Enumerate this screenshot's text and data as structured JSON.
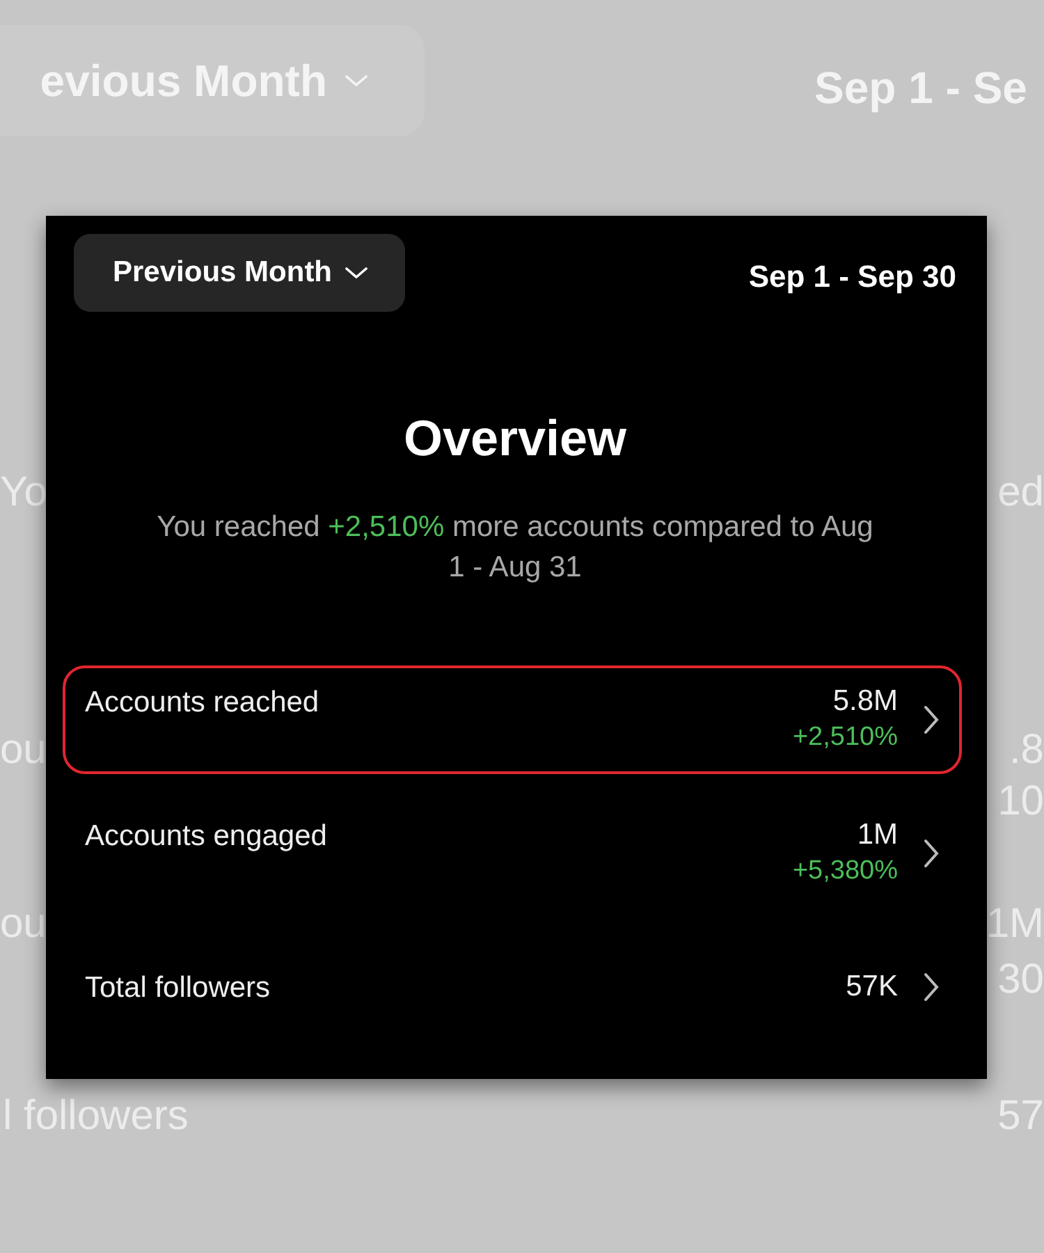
{
  "backdrop": {
    "period_button": {
      "label": "evious Month"
    },
    "date_range": "Sep 1 - Se",
    "left_fragments": [
      "Yo",
      "ou",
      "ou",
      "l followers"
    ],
    "right_fragments": [
      "ed",
      ".8",
      "10",
      "1M",
      "30",
      "57"
    ]
  },
  "card": {
    "period_button": {
      "label": "Previous Month"
    },
    "date_range": "Sep 1 - Sep 30",
    "title": "Overview",
    "summary": "You reached **+2,510%** more accounts compared to Aug 1 - Aug 31",
    "metrics": [
      {
        "label": "Accounts reached",
        "value": "5.8M",
        "change": "+2,510%",
        "highlighted": true
      },
      {
        "label": "Accounts engaged",
        "value": "1M",
        "change": "+5,380%",
        "highlighted": false
      },
      {
        "label": "Total followers",
        "value": "57K",
        "highlighted": false
      }
    ]
  }
}
